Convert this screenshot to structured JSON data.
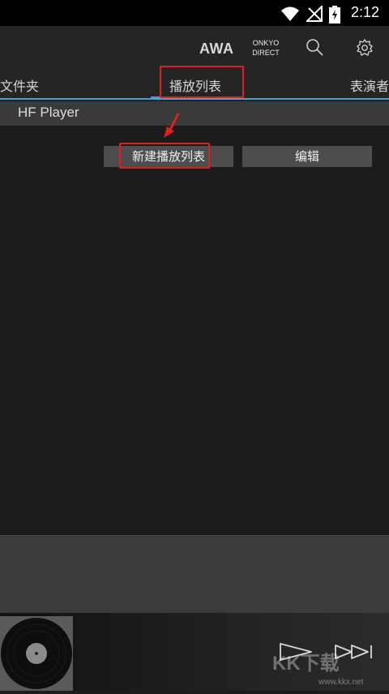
{
  "status_bar": {
    "time": "2:12"
  },
  "header": {
    "awa_label": "AWA",
    "onkyo_line1": "ONKYO",
    "onkyo_line2": "DIRECT"
  },
  "tabs": [
    {
      "label": "文件夹"
    },
    {
      "label": "播放列表",
      "selected": true
    },
    {
      "label": "表演者"
    }
  ],
  "section": {
    "title": "HF Player"
  },
  "actions": {
    "new_playlist": "新建播放列表",
    "edit": "编辑"
  },
  "watermark": {
    "text": "KK下载",
    "url": "www.kkx.net"
  },
  "colors": {
    "accent": "#4a9fd8",
    "highlight_box": "#e0211b"
  }
}
